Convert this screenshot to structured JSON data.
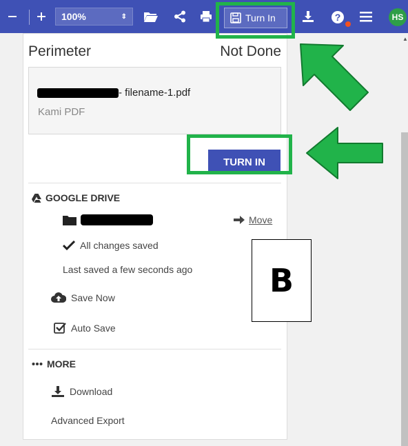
{
  "toolbar": {
    "zoom_value": "100%",
    "turn_in_label": "Turn In",
    "avatar_initials": "HS"
  },
  "panel": {
    "title": "Perimeter",
    "status": "Not Done",
    "file": {
      "name": "- filename-1.pdf",
      "type": "Kami PDF"
    },
    "turn_in_button": "TURN IN",
    "google_drive": {
      "heading": "GOOGLE DRIVE",
      "move_label": "Move",
      "saved_status": "All changes saved",
      "last_saved": "Last saved a few seconds ago",
      "save_now": "Save Now",
      "auto_save": "Auto Save"
    },
    "more": {
      "heading": "MORE",
      "download": "Download",
      "advanced_export": "Advanced Export"
    }
  },
  "annotation": {
    "label": "B",
    "highlight_color": "#21b34a",
    "arrow_color": "#21b34a"
  },
  "colors": {
    "toolbar_bg": "#3f51b5",
    "button_bg": "#3f51b5",
    "avatar_bg": "#2e9e48",
    "notification_dot": "#f4511e"
  }
}
